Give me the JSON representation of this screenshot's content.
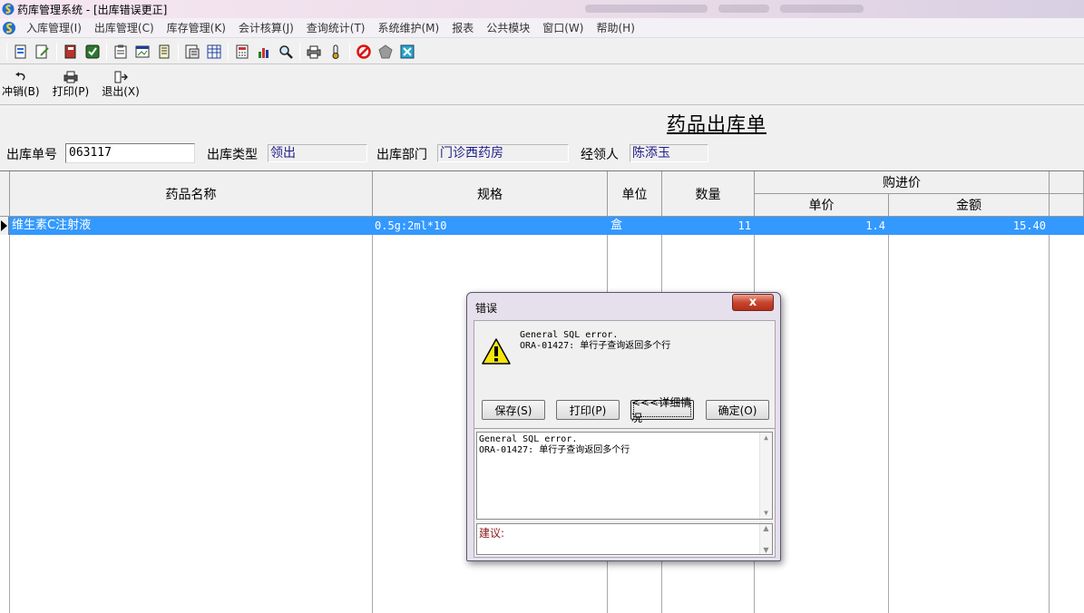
{
  "window": {
    "title": "药库管理系统 - [出库错误更正]"
  },
  "menu": {
    "items": [
      {
        "label": "入库管理(I)"
      },
      {
        "label": "出库管理(C)"
      },
      {
        "label": "库存管理(K)"
      },
      {
        "label": "会计核算(J)"
      },
      {
        "label": "查询统计(T)"
      },
      {
        "label": "系统维护(M)"
      },
      {
        "label": "报表"
      },
      {
        "label": "公共模块"
      },
      {
        "label": "窗口(W)"
      },
      {
        "label": "帮助(H)"
      }
    ]
  },
  "actions": {
    "reverse": "冲销(B)",
    "print": "打印(P)",
    "exit": "退出(X)"
  },
  "form": {
    "title": "药品出库单",
    "order_no_label": "出库单号",
    "order_no": "063117",
    "type_label": "出库类型",
    "type_value": "领出",
    "dept_label": "出库部门",
    "dept_value": "门诊西药房",
    "handler_label": "经领人",
    "handler_value": "陈添玉"
  },
  "grid": {
    "headers": {
      "name": "药品名称",
      "spec": "规格",
      "unit": "单位",
      "qty": "数量",
      "purchase_price": "购进价",
      "unit_price": "单价",
      "amount": "金额"
    },
    "rows": [
      {
        "name": "维生素C注射液",
        "spec": "0.5g:2ml*10",
        "unit": "盒",
        "qty": "11",
        "unit_price": "1.4",
        "amount": "15.40"
      }
    ]
  },
  "dialog": {
    "title": "错误",
    "close_label": "x",
    "message_line1": "General SQL error.",
    "message_line2": "ORA-01427: 单行子查询返回多个行",
    "buttons": {
      "save": "保存(S)",
      "print": "打印(P)",
      "details": "<<<详细情况",
      "ok": "确定(O)"
    },
    "detail_line1": "General SQL error.",
    "detail_line2": "ORA-01427: 单行子查询返回多个行",
    "suggestion_label": "建议:"
  },
  "colors": {
    "selection": "#3399ff",
    "readonly_text": "#1d1d8a",
    "suggestion_text": "#8b1a1a"
  }
}
